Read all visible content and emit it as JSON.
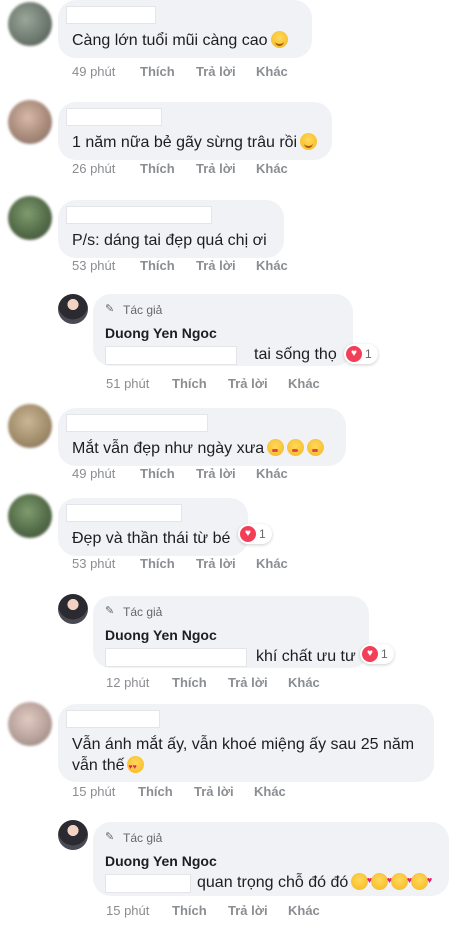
{
  "actions": {
    "like": "Thích",
    "reply": "Trả lời",
    "more": "Khác"
  },
  "author_tag": "Tác giả",
  "icons": {
    "author": "pencil-icon",
    "reaction": "heart-reaction-icon"
  },
  "colors": {
    "bubble": "#f0f2f5",
    "meta": "#8a8d91",
    "heart": "#f33e58"
  },
  "comments": [
    {
      "text": "Càng lớn tuổi mũi càng cao",
      "emoji": [
        "smiling-face"
      ],
      "time": "49 phút"
    },
    {
      "text": "1 năm nữa bẻ gãy sừng trâu rồi",
      "emoji": [
        "laughing-face"
      ],
      "time": "26 phút"
    },
    {
      "text": "P/s: dáng tai đẹp quá chị ơi",
      "emoji": [],
      "time": "53 phút"
    },
    {
      "reply": true,
      "name": "Duong Yen Ngoc",
      "text": "tai sống thọ",
      "reaction_count": "1",
      "time": "51 phút"
    },
    {
      "text": "Mắt vẫn đẹp như ngày xưa",
      "emoji": [
        "kissing-face",
        "kissing-face",
        "kissing-face"
      ],
      "time": "49 phút"
    },
    {
      "text": "Đẹp và thần thái từ bé",
      "reaction_count": "1",
      "time": "53 phút"
    },
    {
      "reply": true,
      "name": "Duong Yen Ngoc",
      "text": "khí chất ưu tư",
      "reaction_count": "1",
      "time": "12 phút"
    },
    {
      "text_line1": "Vẫn ánh mắt ấy, vẫn khoé miệng ấy sau 25 năm",
      "text_line2": "vẫn thế",
      "emoji": [
        "heart-eyes-face"
      ],
      "time": "15 phút"
    },
    {
      "reply": true,
      "name": "Duong Yen Ngoc",
      "text": "quan trọng chỗ đó đó",
      "emoji": [
        "smiling-hearts-face",
        "smiling-hearts-face",
        "smiling-hearts-face",
        "smiling-hearts-face"
      ],
      "time": "15 phút"
    }
  ]
}
